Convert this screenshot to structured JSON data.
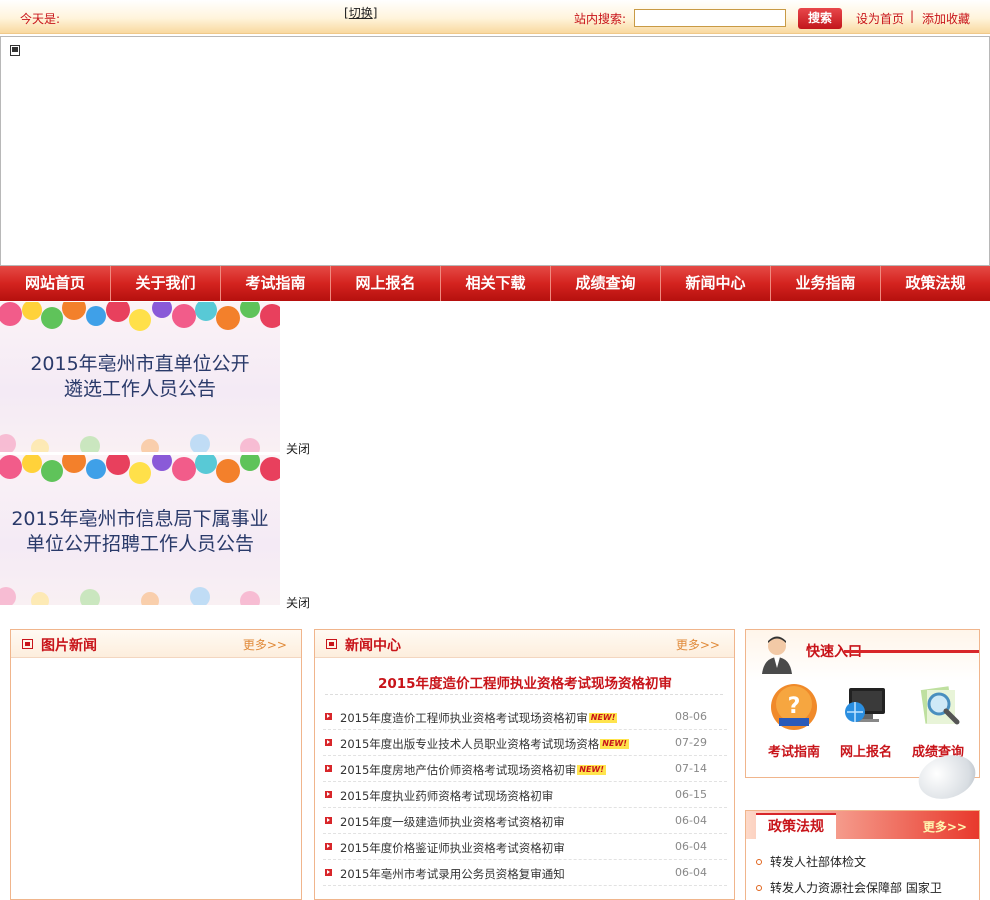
{
  "topbar": {
    "today_label": "今天是:",
    "switch_label": "切换",
    "search_label": "站内搜索:",
    "search_value": "",
    "search_button": "搜索",
    "set_home": "设为首页",
    "separator": "|",
    "add_favorite": "添加收藏"
  },
  "nav": {
    "items": [
      "网站首页",
      "关于我们",
      "考试指南",
      "网上报名",
      "相关下载",
      "成绩查询",
      "新闻中心",
      "业务指南",
      "政策法规"
    ]
  },
  "banners": [
    {
      "line1": "2015年亳州市直单位公开",
      "line2": "遴选工作人员公告",
      "close": "关闭"
    },
    {
      "line1": "2015年亳州市信息局下属事业",
      "line2": "单位公开招聘工作人员公告",
      "close": "关闭"
    }
  ],
  "photo_news": {
    "title": "图片新闻",
    "more": "更多>>"
  },
  "news_center": {
    "title": "新闻中心",
    "more": "更多>>",
    "headline": "2015年度造价工程师执业资格考试现场资格初审",
    "new_badge": "NEW!",
    "items": [
      {
        "title": "2015年度造价工程师执业资格考试现场资格初审",
        "date": "08-06",
        "is_new": true
      },
      {
        "title": "2015年度出版专业技术人员职业资格考试现场资格",
        "date": "07-29",
        "is_new": true
      },
      {
        "title": "2015年度房地产估价师资格考试现场资格初审",
        "date": "07-14",
        "is_new": true
      },
      {
        "title": "2015年度执业药师资格考试现场资格初审",
        "date": "06-15",
        "is_new": false
      },
      {
        "title": "2015年度一级建造师执业资格考试资格初审",
        "date": "06-04",
        "is_new": false
      },
      {
        "title": "2015年度价格鉴证师执业资格考试资格初审",
        "date": "06-04",
        "is_new": false
      },
      {
        "title": "2015年亳州市考试录用公务员资格复审通知",
        "date": "06-04",
        "is_new": false
      }
    ]
  },
  "quick_entry": {
    "title": "快速入口",
    "items": [
      {
        "label": "考试指南",
        "icon": "book-question-icon"
      },
      {
        "label": "网上报名",
        "icon": "monitor-globe-icon"
      },
      {
        "label": "成绩查询",
        "icon": "magnifier-icon"
      }
    ]
  },
  "policy": {
    "title": "政策法规",
    "more": "更多>>",
    "items": [
      "转发人社部体检文",
      "转发人力资源社会保障部 国家卫"
    ]
  },
  "colors": {
    "brand_red": "#c8141a",
    "nav_red": "#d4231f",
    "accent_orange": "#f0b58c"
  }
}
